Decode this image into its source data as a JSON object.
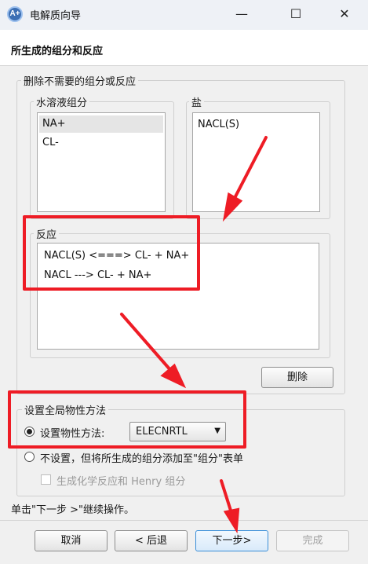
{
  "window": {
    "title": "电解质向导",
    "app_icon_text": "A+",
    "minimize_glyph": "—",
    "maximize_glyph": "☐",
    "close_glyph": "✕"
  },
  "header": {
    "title": "所生成的组分和反应"
  },
  "remove_group": {
    "label": "删除不需要的组分或反应",
    "aqueous": {
      "label": "水溶液组分",
      "items": [
        "NA+",
        "CL-"
      ]
    },
    "salt": {
      "label": "盐",
      "items": [
        "NACL(S)"
      ]
    },
    "reactions": {
      "label": "反应",
      "items": [
        "NACL(S) <===> CL- + NA+",
        "NACL ---> CL- + NA+"
      ]
    },
    "delete_button": "删除"
  },
  "global_property": {
    "label": "设置全局物性方法",
    "set_method_label": "设置物性方法:",
    "method_value": "ELECNRTL",
    "no_set_label": "不设置，但将所生成的组分添加至\"组分\"表单",
    "generate_checkbox_label": "生成化学反应和 Henry 组分"
  },
  "footer": {
    "hint": "单击\"下一步 >\"继续操作。",
    "cancel": "取消",
    "back": "< 后退",
    "next": "下一步>",
    "finish": "完成"
  },
  "colors": {
    "annotation": "#ee1c25",
    "focus": "#3a8fd8"
  }
}
